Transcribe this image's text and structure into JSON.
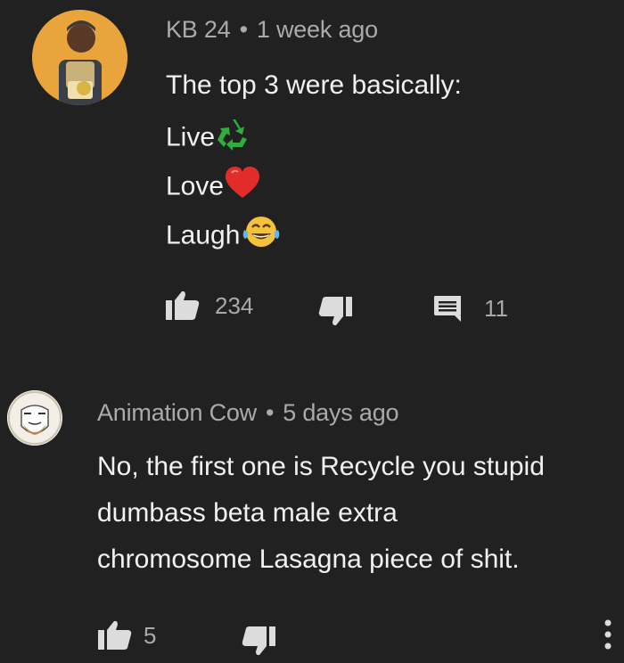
{
  "comments": [
    {
      "author": "KB 24",
      "separator": "•",
      "time": "1 week ago",
      "lines": [
        {
          "text": "The top 3 were basically:",
          "emoji": ""
        },
        {
          "text": "Live",
          "emoji": "recycle-icon"
        },
        {
          "text": "Love",
          "emoji": "heart-icon"
        },
        {
          "text": "Laugh",
          "emoji": "tears-of-joy-icon"
        }
      ],
      "likes": "234",
      "replies": "11"
    },
    {
      "author": "Animation Cow",
      "separator": "•",
      "time": "5 days ago",
      "lines": [
        {
          "text": "No, the first one is Recycle you stupid"
        },
        {
          "text": "dumbass beta male extra"
        },
        {
          "text": "chromosome Lasagna piece of shit."
        }
      ],
      "likes": "5"
    }
  ],
  "colors": {
    "background": "#212121",
    "meta_text": "#aaaaaa",
    "body_text": "#f1f1f1",
    "icon": "#dcdcdc"
  }
}
